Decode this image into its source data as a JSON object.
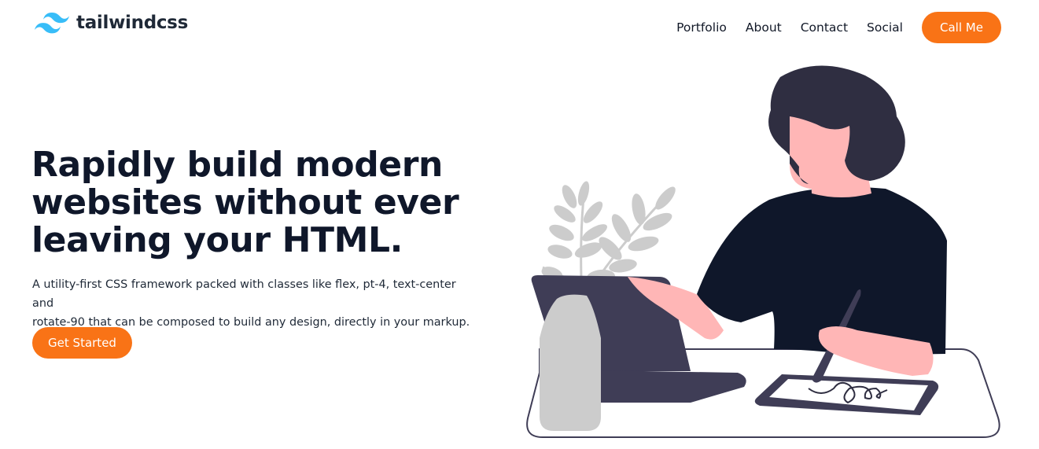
{
  "brand": {
    "name": "tailwindcss",
    "icon": "tailwind-logo-icon",
    "color": "#38bdf8"
  },
  "nav": {
    "links": [
      "Portfolio",
      "About",
      "Contact",
      "Social"
    ],
    "cta_label": "Call Me"
  },
  "hero": {
    "title_lines": [
      "Rapidly build modern",
      "websites without ever",
      "leaving your HTML."
    ],
    "subtitle_lines": [
      "A utility-first CSS framework packed with classes like flex, pt-4, text-center and",
      "rotate-90 that can be composed to build any design, directly in your markup."
    ],
    "cta_label": "Get Started"
  },
  "illustration": {
    "subject": "woman-working-at-desk",
    "colors": {
      "accent": "#f97316",
      "shirt": "#0f172a",
      "hair": "#2f2e41",
      "skin": "#ffb6b6",
      "laptop": "#3f3d56",
      "plant": "#cccccc"
    }
  }
}
